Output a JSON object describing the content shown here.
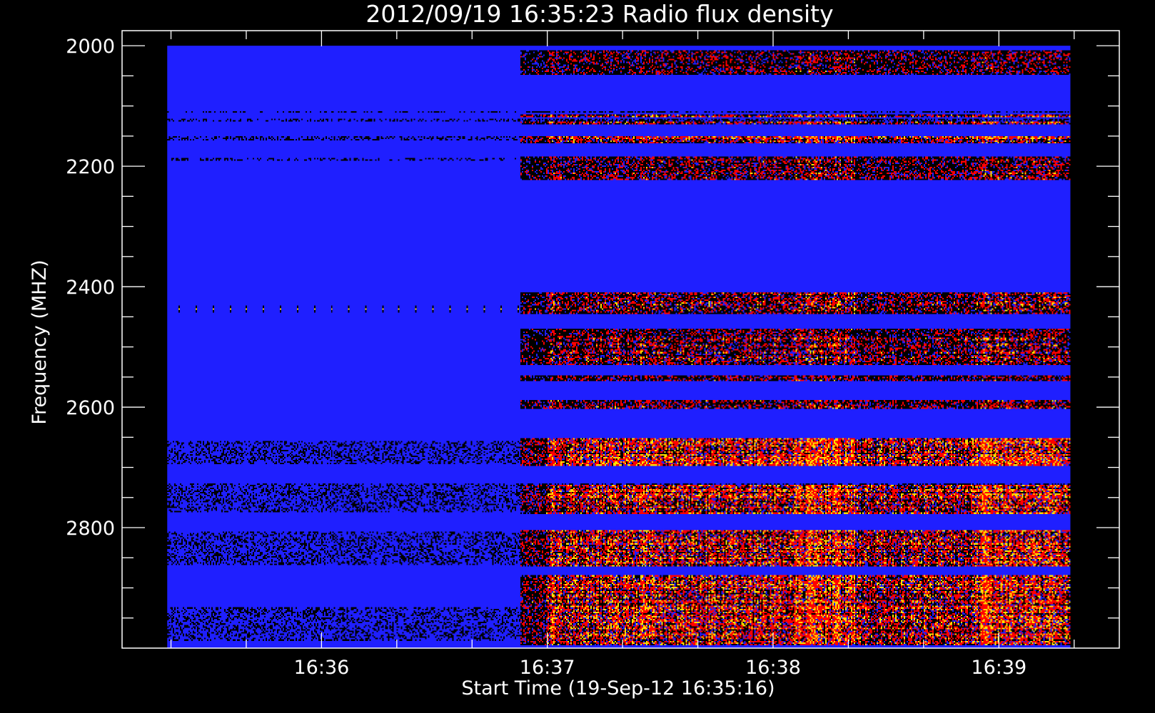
{
  "chart_data": {
    "type": "heatmap",
    "title": "2012/09/19 16:35:23 Radio flux density",
    "xlabel": "Start Time (19-Sep-12 16:35:16)",
    "ylabel": "Frequency (MHZ)",
    "x_ticks": [
      "16:36",
      "16:37",
      "16:38",
      "16:39"
    ],
    "x_tick_values_s": [
      44,
      104,
      164,
      224
    ],
    "x_minor_step_s": 20,
    "x_range_s": [
      -9,
      256
    ],
    "data_x_range_s": [
      3,
      243
    ],
    "y_ticks": [
      2000,
      2200,
      2400,
      2600,
      2800
    ],
    "y_minor_step": 50,
    "y_range_mhz": [
      1975,
      3000
    ],
    "data_y_range_mhz": [
      2000,
      3000
    ],
    "y_reversed": true,
    "colormap": [
      "#000000",
      "#1f1fff",
      "#ff0000",
      "#ffdd00"
    ],
    "background_color": "#1f1fff",
    "dark_lanes_mhz": [
      [
        2108,
        2112
      ],
      [
        2120,
        2126
      ],
      [
        2150,
        2157
      ],
      [
        2186,
        2192
      ],
      [
        2655,
        2695
      ],
      [
        2727,
        2775
      ],
      [
        2806,
        2862
      ],
      [
        2932,
        2988
      ]
    ],
    "emission_bands_mhz": [
      {
        "range": [
          2113,
          2119
        ],
        "intensity": 0.7
      },
      {
        "range": [
          2126,
          2130
        ],
        "intensity": 0.9
      },
      {
        "range": [
          2150,
          2162
        ],
        "intensity": 0.9
      },
      {
        "range": [
          2184,
          2222
        ],
        "intensity": 0.5
      },
      {
        "range": [
          2410,
          2445
        ],
        "intensity": 0.55
      },
      {
        "range": [
          2470,
          2530
        ],
        "intensity": 0.55
      },
      {
        "range": [
          2548,
          2558
        ],
        "intensity": 0.5
      },
      {
        "range": [
          2588,
          2602
        ],
        "intensity": 0.5
      },
      {
        "range": [
          2652,
          2698
        ],
        "intensity": 1.0
      },
      {
        "range": [
          2728,
          2778
        ],
        "intensity": 1.0
      },
      {
        "range": [
          2803,
          2865
        ],
        "intensity": 1.0
      },
      {
        "range": [
          2880,
          2995
        ],
        "intensity": 1.0
      },
      {
        "range": [
          2008,
          2048
        ],
        "intensity": 0.35
      }
    ],
    "bursts_s": [
      {
        "range": [
          97,
          104
        ],
        "strength": 0.35
      },
      {
        "range": [
          104,
          170
        ],
        "strength": 0.75
      },
      {
        "range": [
          170,
          186
        ],
        "strength": 1.0
      },
      {
        "range": [
          186,
          218
        ],
        "strength": 0.6
      },
      {
        "range": [
          218,
          224
        ],
        "strength": 1.0
      },
      {
        "range": [
          224,
          243
        ],
        "strength": 0.85
      }
    ],
    "periodic_blips": {
      "frequency_mhz": 2435,
      "start_s": 6,
      "end_s": 243,
      "spacing_s": 4.5
    }
  }
}
